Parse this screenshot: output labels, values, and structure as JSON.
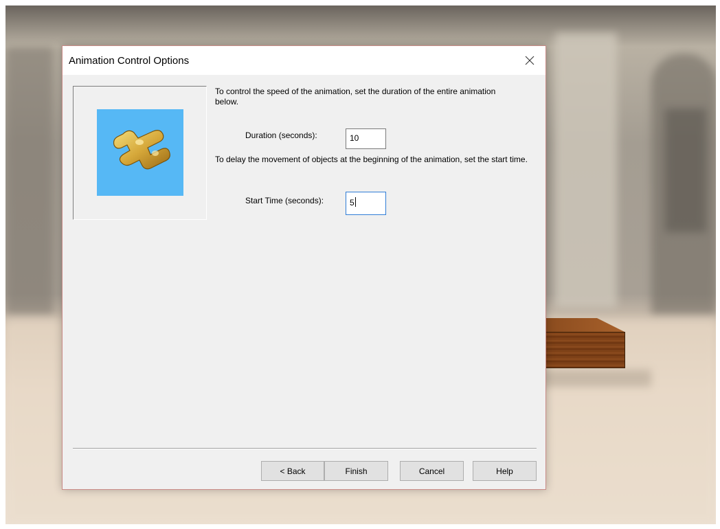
{
  "dialog": {
    "title": "Animation Control Options",
    "close_icon": "close-icon",
    "picture_icon": "animated-part-icon",
    "picture_bg_color": "#56b8f5",
    "instruction_speed": "To control the speed of the animation, set the duration of the entire animation below.",
    "duration_label": "Duration (seconds):",
    "duration_value": "10",
    "instruction_delay": "To delay the movement of objects at the beginning of the animation, set the start time.",
    "start_time_label": "Start Time (seconds):",
    "start_time_value": "5",
    "buttons": {
      "back": "< Back",
      "finish": "Finish",
      "cancel": "Cancel",
      "help": "Help"
    }
  }
}
